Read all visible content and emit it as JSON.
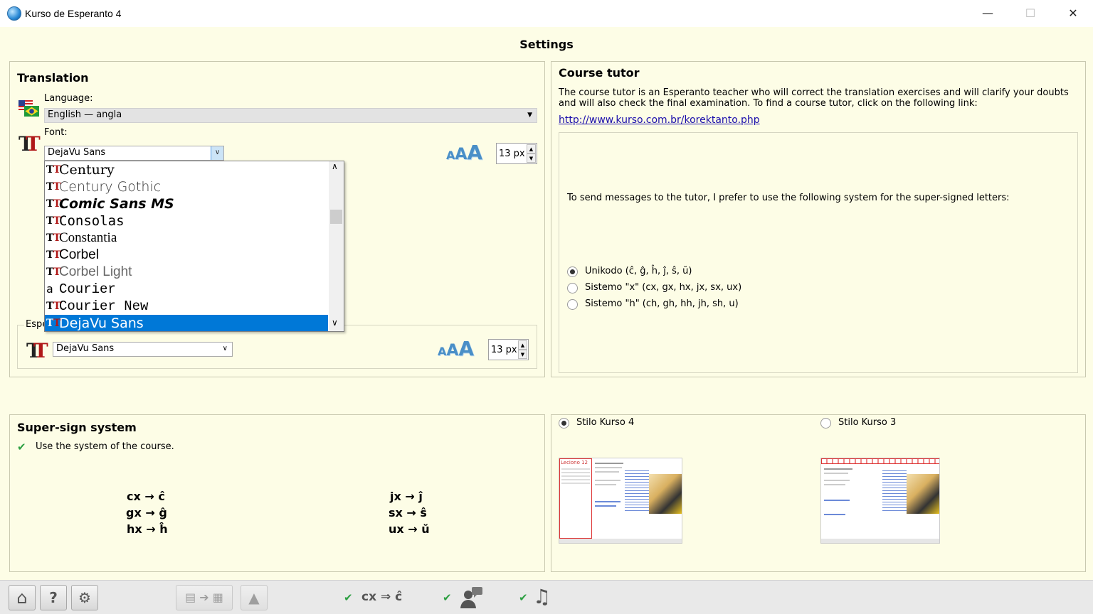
{
  "window": {
    "title": "Kurso de Esperanto 4",
    "minimize": "—",
    "maximize": "☐",
    "close": "✕"
  },
  "header": {
    "title": "Settings"
  },
  "translation": {
    "title": "Translation",
    "language_label": "Language:",
    "language_value": "English — angla",
    "font_label": "Font:",
    "font_value": "DejaVu Sans",
    "font_size": "13 px",
    "font_list": [
      {
        "name": "Century",
        "icon": "truetype-icon"
      },
      {
        "name": "Century Gothic",
        "icon": "truetype-icon"
      },
      {
        "name": "Comic Sans MS",
        "icon": "truetype-icon"
      },
      {
        "name": "Consolas",
        "icon": "truetype-icon"
      },
      {
        "name": "Constantia",
        "icon": "truetype-icon"
      },
      {
        "name": "Corbel",
        "icon": "truetype-icon"
      },
      {
        "name": "Corbel Light",
        "icon": "truetype-icon"
      },
      {
        "name": "Courier",
        "icon": "bitmap-font-icon"
      },
      {
        "name": "Courier New",
        "icon": "truetype-icon"
      },
      {
        "name": "DejaVu Sans",
        "icon": "truetype-icon",
        "selected": true
      }
    ],
    "esperanto_label": "Espe",
    "esperanto_font_value": "DejaVu Sans",
    "esperanto_font_size": "13 px",
    "aaa": [
      "A",
      "A",
      "A"
    ]
  },
  "tutor": {
    "title": "Course tutor",
    "description": "The course tutor is an Esperanto teacher who will correct the translation exercises and will clarify your doubts and will also check the final examination.  To find a course tutor, click on the following link:",
    "link": "http://www.kurso.com.br/korektanto.php",
    "prefer_text": "To send messages to the tutor, I prefer to use the following system for the super-signed letters:",
    "options": [
      {
        "label": "Unikodo (ĉ, ĝ, ĥ, ĵ, ŝ, ŭ)",
        "selected": true
      },
      {
        "label": "Sistemo \"x\" (cx, gx, hx, jx, sx, ux)",
        "selected": false
      },
      {
        "label": "Sistemo \"h\" (ch, gh, hh, jh, sh, u)",
        "selected": false
      }
    ]
  },
  "supersign": {
    "title": "Super-sign system",
    "use_course": "Use the system of the course.",
    "left": [
      "cx → ĉ",
      "gx → ĝ",
      "hx → ĥ"
    ],
    "right": [
      "jx →  ĵ",
      "sx → ŝ",
      "ux → ŭ"
    ]
  },
  "style": {
    "option4": "Stilo Kurso 4",
    "option3": "Stilo Kurso 3",
    "thumb4_title": "Leciono 12",
    "selected": "Stilo Kurso 4"
  },
  "toolbar": {
    "home_icon": "⌂",
    "help_icon": "?",
    "settings_icon": "⚙",
    "check": "✔",
    "cx_label": "cx ⇒ ĉ",
    "music_icon": "♫"
  }
}
